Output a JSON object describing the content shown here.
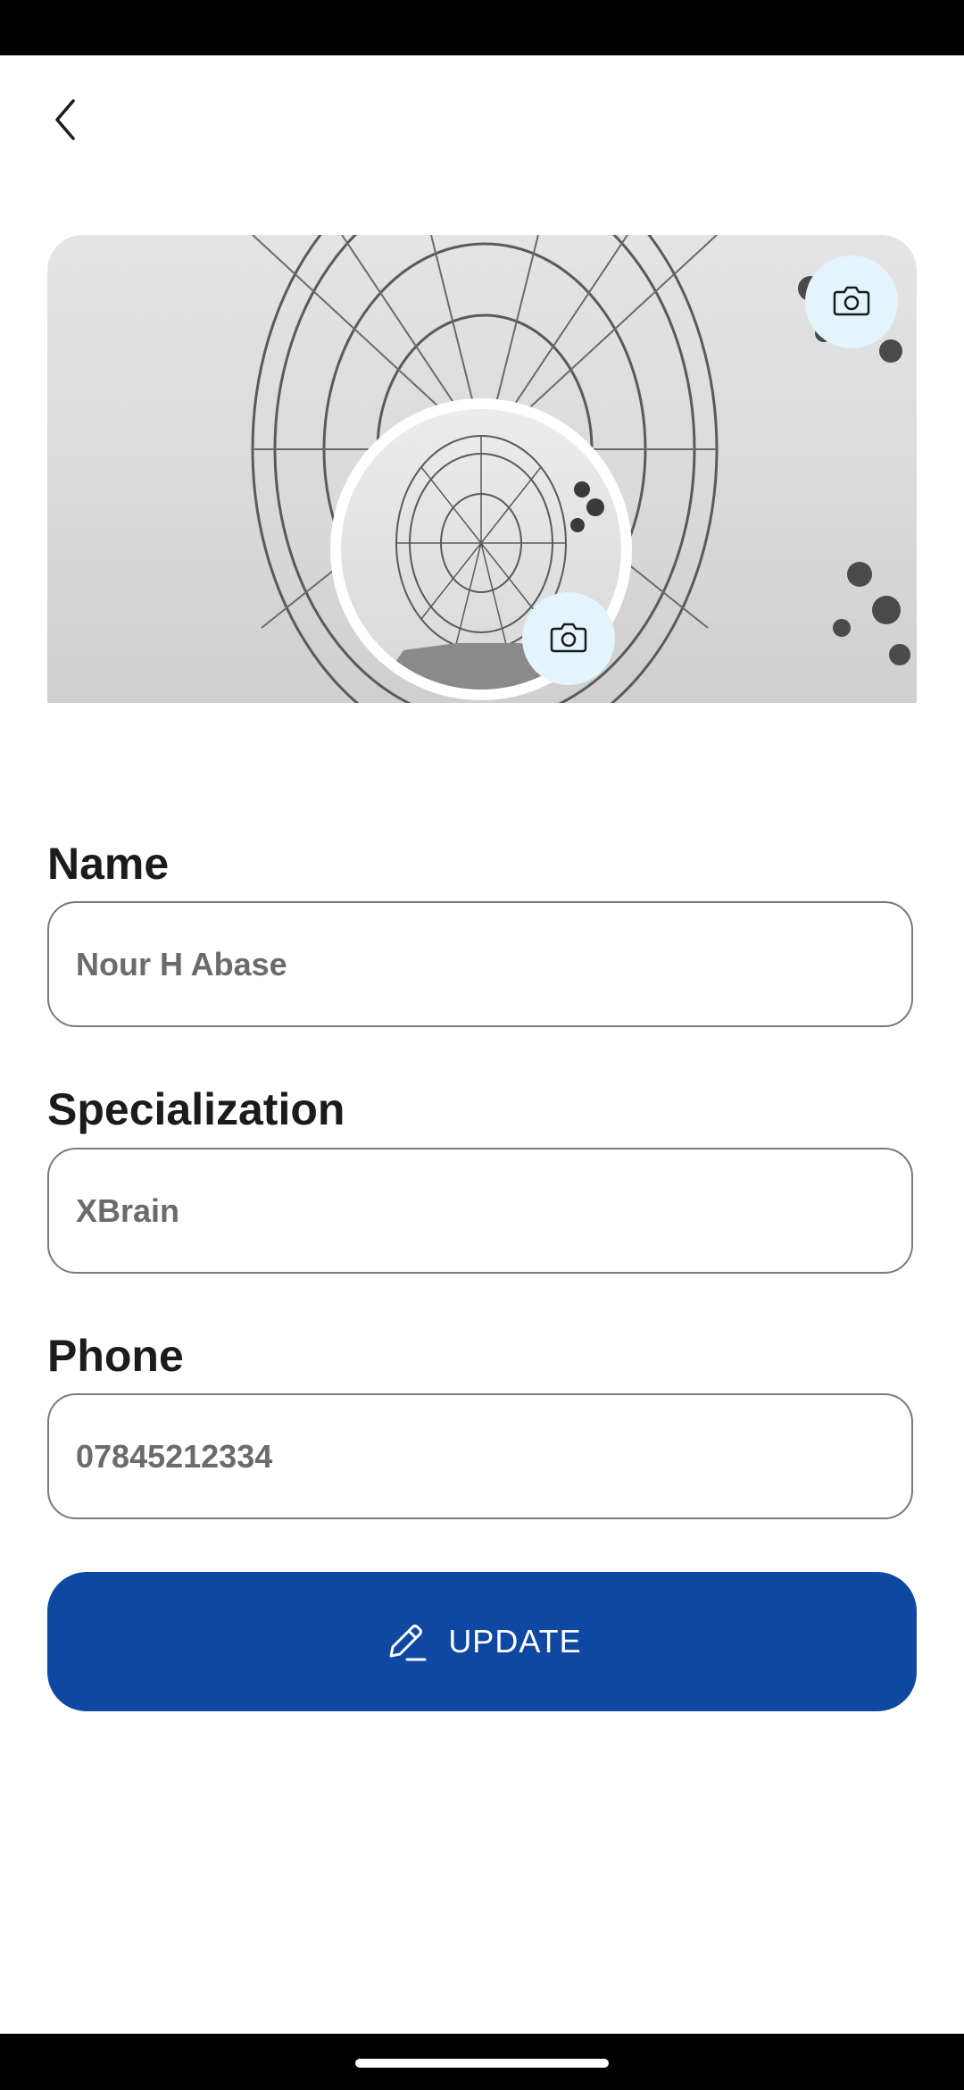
{
  "form": {
    "name_label": "Name",
    "name_value": "Nour H Abase",
    "specialization_label": "Specialization",
    "specialization_value": "XBrain",
    "phone_label": "Phone",
    "phone_value": "07845212334"
  },
  "update_button": {
    "label": "UPDATE",
    "icon": "edit-pencil-icon",
    "color": "#0f48a3"
  },
  "icons": {
    "back": "chevron-left-icon",
    "cover_camera": "camera-icon",
    "avatar_camera": "camera-icon"
  },
  "colors": {
    "camera_button_bg": "#e3f4fc",
    "label_text": "#1b1b1b",
    "input_text": "#6b6b6b"
  }
}
